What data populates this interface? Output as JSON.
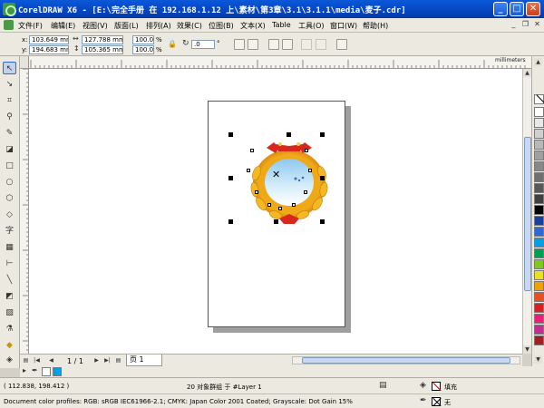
{
  "window": {
    "title": "CorelDRAW X6 - [E:\\完全手册 在 192.168.1.12 上\\素材\\第3章\\3.1\\3.1.1\\media\\麦子.cdr]",
    "minimize": "_",
    "maximize": "□",
    "close": "✕"
  },
  "menu": {
    "items": [
      "文件(F)",
      "编辑(E)",
      "视图(V)",
      "版面(L)",
      "排列(A)",
      "效果(C)",
      "位图(B)",
      "文本(X)",
      "Table",
      "工具(O)",
      "窗口(W)",
      "帮助(H)"
    ],
    "mdi_minimize": "_",
    "mdi_restore": "❐",
    "mdi_close": "✕"
  },
  "property_bar": {
    "x_label": "x:",
    "x_value": "103.649 mm",
    "y_label": "y:",
    "y_value": "194.683 mm",
    "w_value": "127.788 mm",
    "h_value": "105.365 mm",
    "scale_x": "100.0",
    "scale_y": "100.0",
    "percent": "%",
    "rotation": ".0",
    "rotation_unit": "°"
  },
  "rulers": {
    "units": "millimeters"
  },
  "page_nav": {
    "counter": "1 / 1",
    "tab_label": "页 1"
  },
  "status": {
    "selection_info": "20 对象群组 于 #Layer 1",
    "coordinates": "( 112.838, 198.412 )",
    "fill_label": "填充",
    "outline_label": "无",
    "color_profiles": "Document color profiles: RGB: sRGB IEC61966-2.1; CMYK: Japan Color 2001 Coated; Grayscale: Dot Gain 15%"
  },
  "palette_colors": [
    "#ffffff",
    "#e8e8e8",
    "#d0d0d0",
    "#b8b8b8",
    "#a0a0a0",
    "#888888",
    "#707070",
    "#585858",
    "#404040",
    "#000000",
    "#1a3fa0",
    "#2a6ad8",
    "#00a0e8",
    "#00a050",
    "#80c820",
    "#e8e020",
    "#f0a000",
    "#e85020",
    "#d82020",
    "#e8207a",
    "#c03090",
    "#a02020"
  ],
  "doc_palette_colors": [
    "#00a0e8"
  ]
}
